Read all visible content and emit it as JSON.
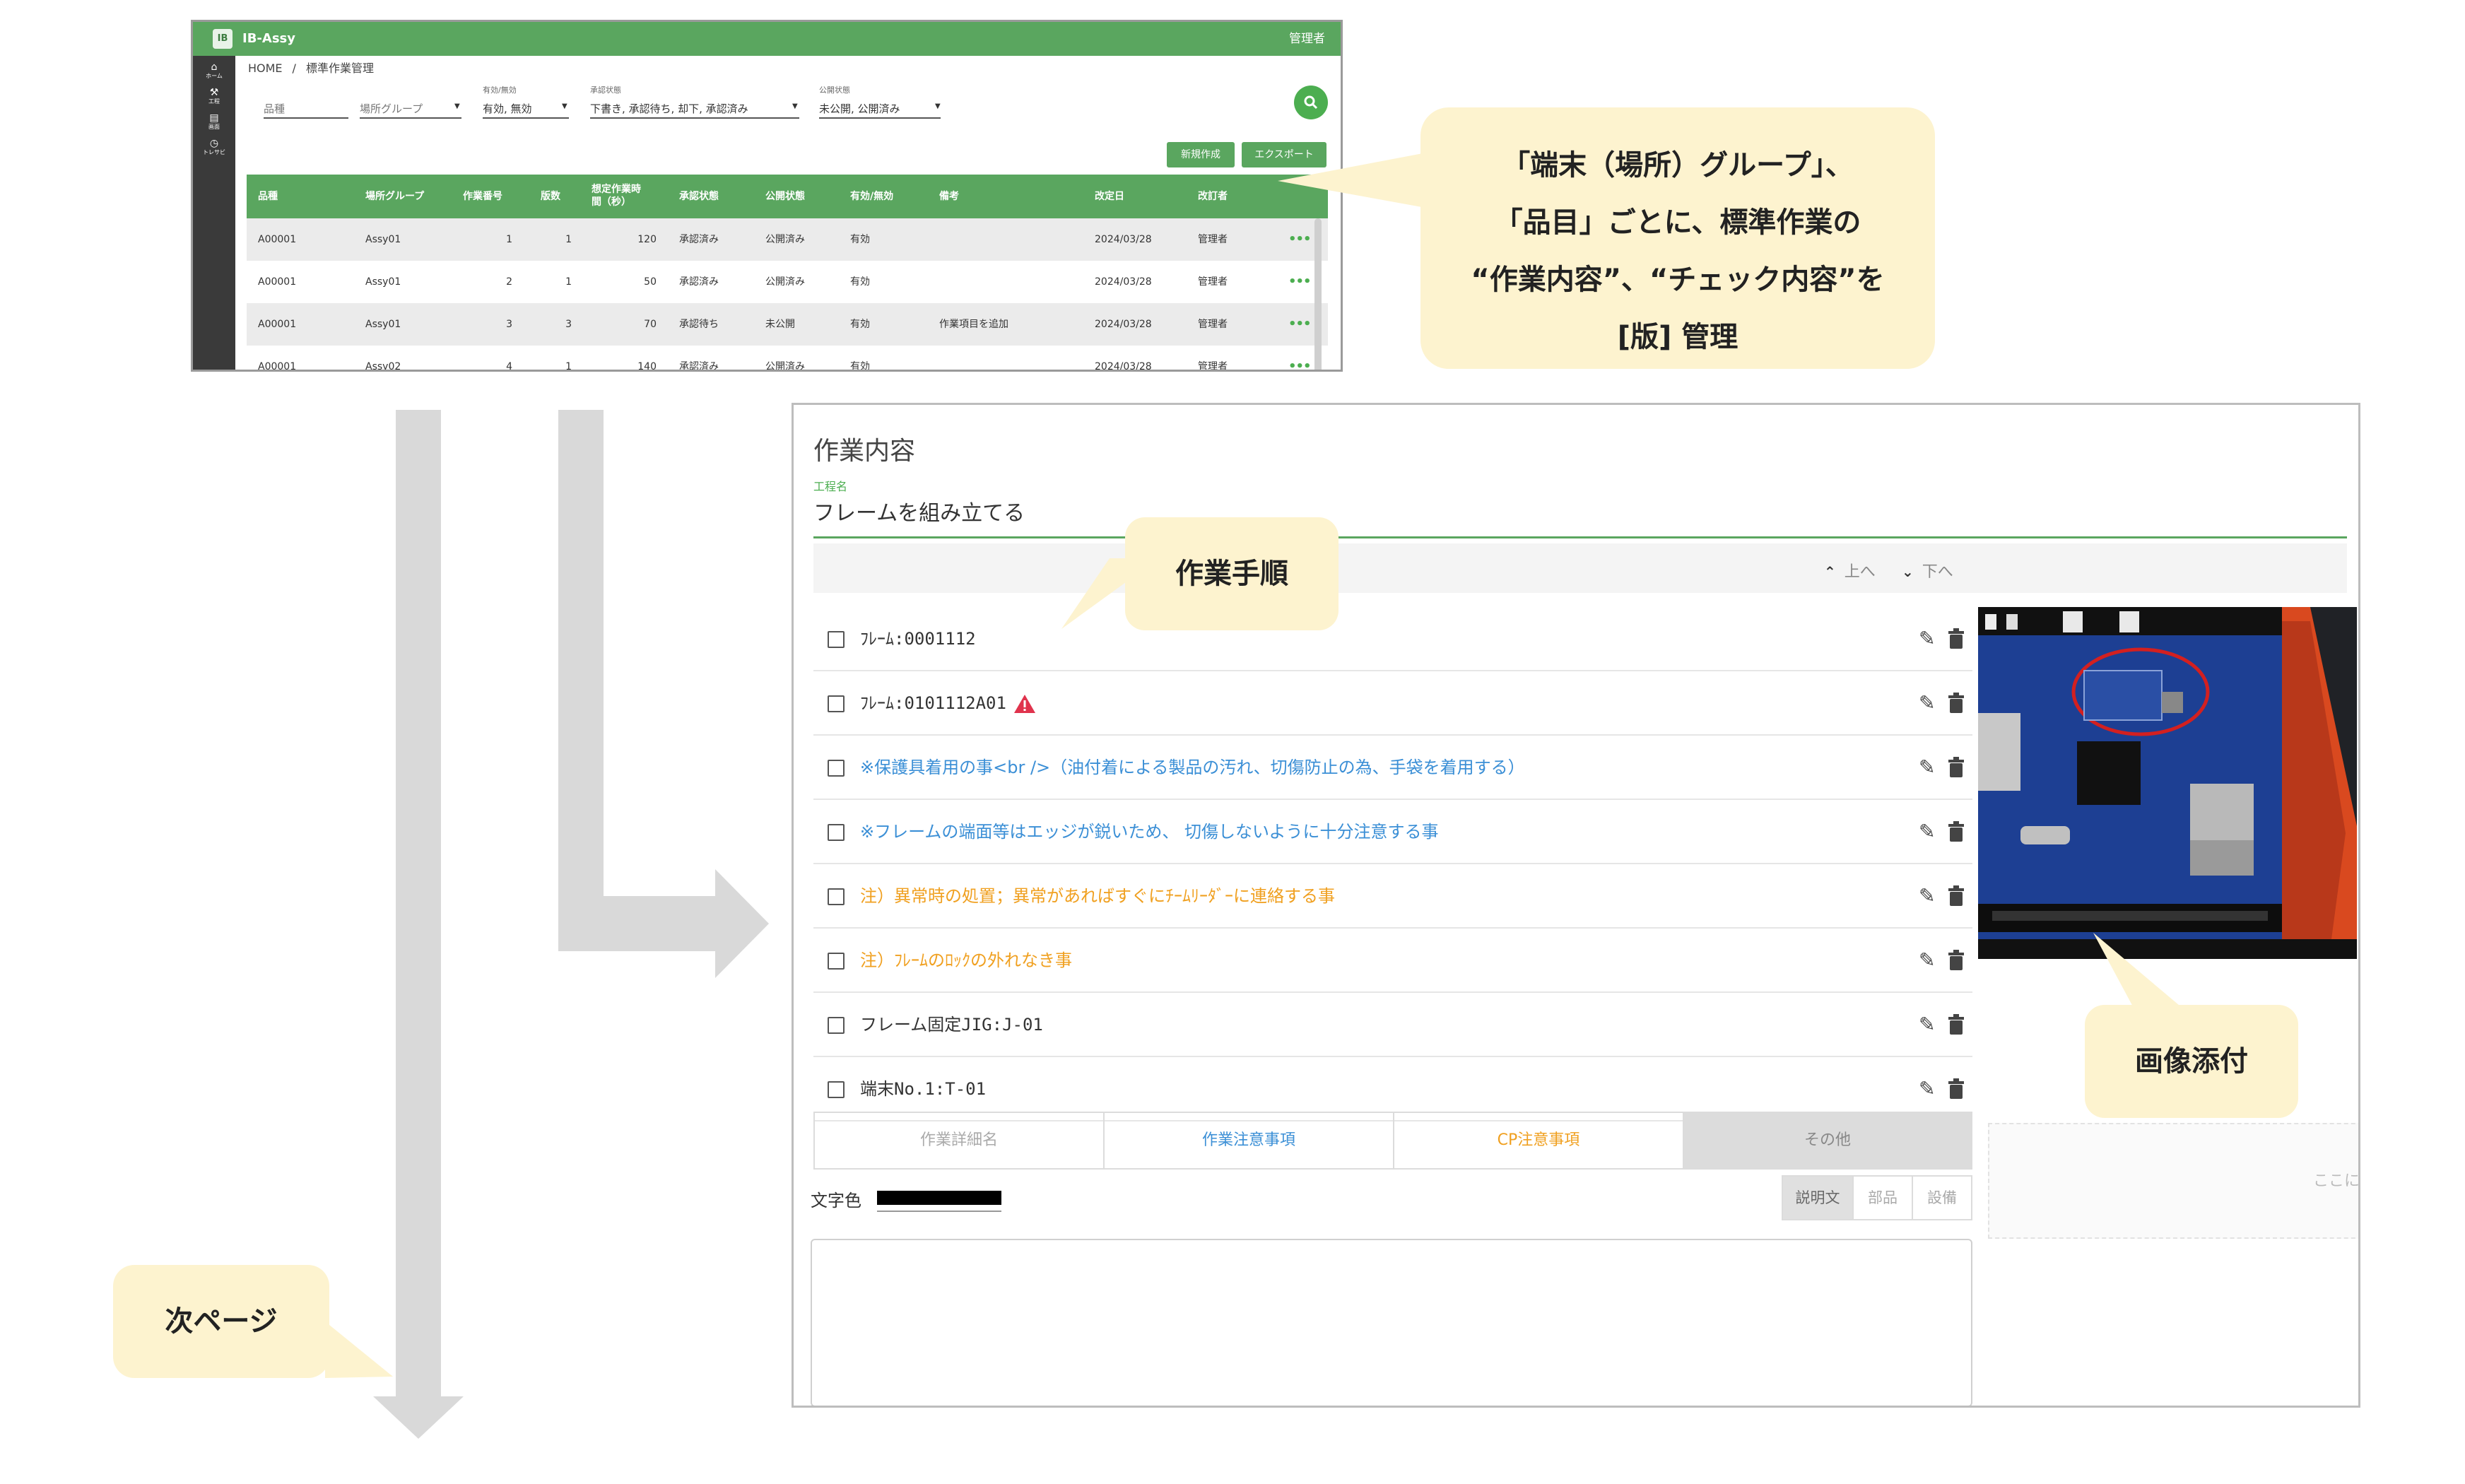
{
  "list_screen": {
    "app_name": "IB-Assy",
    "logo_text": "IB",
    "user": "管理者",
    "sidebar": [
      {
        "label": "ホーム",
        "icon": "home-icon"
      },
      {
        "label": "工程",
        "icon": "tools-icon"
      },
      {
        "label": "画面",
        "icon": "document-icon"
      },
      {
        "label": "トレサビ",
        "icon": "history-icon"
      }
    ],
    "breadcrumb": {
      "home": "HOME",
      "separator": "/",
      "current": "標準作業管理"
    },
    "filters": [
      {
        "label": "",
        "value": "品種"
      },
      {
        "label": "",
        "value": "場所グループ"
      },
      {
        "label": "有効/無効",
        "value": "有効, 無効"
      },
      {
        "label": "承認状態",
        "value": "下書き, 承認待ち, 却下, 承認済み"
      },
      {
        "label": "公開状態",
        "value": "未公開, 公開済み"
      }
    ],
    "buttons": {
      "new": "新規作成",
      "export": "エクスポート"
    },
    "columns": [
      "品種",
      "場所グループ",
      "作業番号",
      "版数",
      "想定作業時間（秒）",
      "承認状態",
      "公開状態",
      "有効/無効",
      "備考",
      "改定日",
      "改訂者"
    ],
    "rows": [
      [
        "A00001",
        "Assy01",
        "1",
        "1",
        "120",
        "承認済み",
        "公開済み",
        "有効",
        "",
        "2024/03/28",
        "管理者"
      ],
      [
        "A00001",
        "Assy01",
        "2",
        "1",
        "50",
        "承認済み",
        "公開済み",
        "有効",
        "",
        "2024/03/28",
        "管理者"
      ],
      [
        "A00001",
        "Assy01",
        "3",
        "3",
        "70",
        "承認待ち",
        "未公開",
        "有効",
        "作業項目を追加",
        "2024/03/28",
        "管理者"
      ],
      [
        "A00001",
        "Assy02",
        "4",
        "1",
        "140",
        "承認済み",
        "公開済み",
        "有効",
        "",
        "2024/03/28",
        "管理者"
      ]
    ],
    "more_label": "•••"
  },
  "callouts": {
    "management": [
      "「端末（場所）グループ」、",
      "「品目」ごとに、標準作業の",
      "“作業内容”、“チェック内容”を",
      "[版] 管理"
    ],
    "steps": "作業手順",
    "image": "画像添付",
    "next": "次ページ"
  },
  "detail_screen": {
    "title": "作業内容",
    "process_label": "工程名",
    "process_value": "フレームを組み立てる",
    "up_label": "上へ",
    "down_label": "下へ",
    "steps": [
      {
        "text": "ﾌﾚｰﾑ:0001112",
        "style": "dark",
        "warn": false
      },
      {
        "text": "ﾌﾚｰﾑ:0101112A01",
        "style": "dark",
        "warn": true
      },
      {
        "text": "※保護具着用の事<br />（油付着による製品の汚れ、切傷防止の為、手袋を着用する）",
        "style": "blue",
        "warn": false
      },
      {
        "text": "※フレームの端面等はエッジが鋭いため、 切傷しないように十分注意する事",
        "style": "blue",
        "warn": false
      },
      {
        "text": "注）異常時の処置；異常があればすぐにﾁｰﾑﾘｰﾀﾞｰに連絡する事",
        "style": "orange",
        "warn": false
      },
      {
        "text": "注）ﾌﾚｰﾑのﾛｯｸの外れなき事",
        "style": "orange",
        "warn": false
      },
      {
        "text": "フレーム固定JIG:J-01",
        "style": "dark",
        "warn": false
      },
      {
        "text": "端末No.1:T-01",
        "style": "dark",
        "warn": false
      }
    ],
    "tabs": [
      "作業詳細名",
      "作業注意事項",
      "CP注意事項",
      "その他"
    ],
    "color_label": "文字色",
    "color_value": "#000000",
    "segments": [
      "説明文",
      "部品",
      "設備"
    ],
    "drop_hint": "ここに"
  },
  "colors": {
    "accent": "#5aa65f",
    "callout": "#fdf3cf",
    "arrow": "#d9d9d9",
    "info": "#3b8fd6",
    "caution": "#f0a020",
    "warning": "#e0334d"
  }
}
